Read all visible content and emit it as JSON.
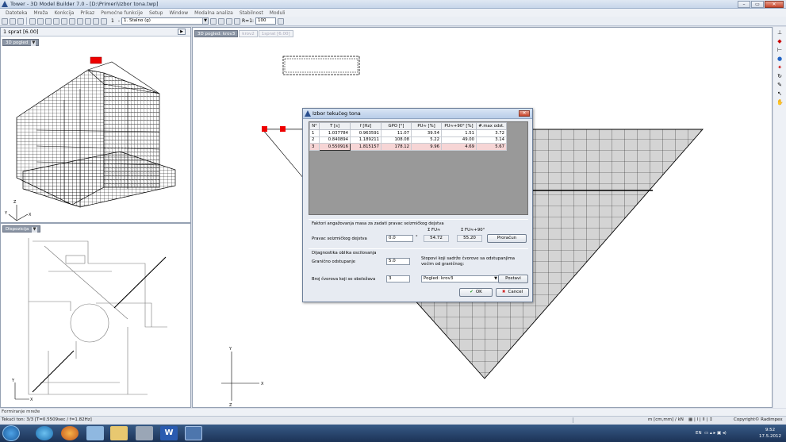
{
  "window": {
    "title": "Tower - 3D Model Builder 7.0 - [D:\\Primeri\\Izbor tona.twp]",
    "controls": [
      "–",
      "▭",
      "✕"
    ]
  },
  "menu": [
    "Datoteka",
    "Mreža",
    "Konkcija",
    "Prikaz",
    "Pomoćne funkcije",
    "Setup",
    "Window",
    "Modalna analiza",
    "Stabilnost",
    "Moduli"
  ],
  "toolbar": {
    "load_case": "1. Stalno (g)",
    "load_index": "1",
    "ratio_label": "R=1:",
    "ratio_value": "100"
  },
  "left_top": {
    "header": "1 sprat  [6.00]",
    "view_label": "3D pogled"
  },
  "left_bottom": {
    "view_label": "Dispozicija"
  },
  "main_view": {
    "tabs": [
      "3D pogled: krov3",
      "krov2",
      "1sprat [6.00]"
    ]
  },
  "dialog": {
    "title": "Izbor tekućeg tona",
    "columns": [
      "N°",
      "T [s]",
      "f [Hz]",
      "GPO [°]",
      "PU≈ [%]",
      "PU≈+90° [%]",
      "#.max odst."
    ],
    "rows": [
      [
        "1",
        "1.037784",
        "0.963591",
        "11.07",
        "39.54",
        "1.51",
        "3.72"
      ],
      [
        "2",
        "0.840894",
        "1.189211",
        "108.08",
        "5.22",
        "49.00",
        "3.14"
      ],
      [
        "3",
        "0.550916",
        "1.815157",
        "178.12",
        "9.96",
        "4.69",
        "5.67"
      ]
    ],
    "mass_section": "Faktori angažovanja masa za zadati pravac seizmičkog dejstva",
    "sum_a_label": "Σ FU≈",
    "sum_b_label": "Σ FU≈+90°",
    "direction_label": "Pravac seizmičkog dejstva",
    "direction_value": "0.0",
    "direction_unit": "°",
    "sum_a_value": "54.72",
    "sum_b_value": "55.20",
    "calc_button": "Proračun",
    "diag_section": "Dijagnostika oblika oscilovanja",
    "limit_label": "Granično odstupanje",
    "limit_value": "5.0",
    "limit_note": "Stopovi koji sadrže čvorove sa odstupanjima većim od graničnog:",
    "nodes_label": "Broj čvorova koji se obeležava",
    "nodes_value": "3",
    "view_select": "Pogled: krov3",
    "set_button": "Postavi",
    "ok_button": "OK",
    "cancel_button": "Cancel"
  },
  "status": {
    "line1": "Formiranje mreže",
    "line2": "Tekući ton: 3/3 [T=0.5509sec / f=1.82Hz]",
    "units": "m [cm,mm] / kN",
    "copyright": "Copyright© Radimpex"
  },
  "taskbar": {
    "language": "EN",
    "time": "9:52",
    "date": "17.5.2012"
  }
}
